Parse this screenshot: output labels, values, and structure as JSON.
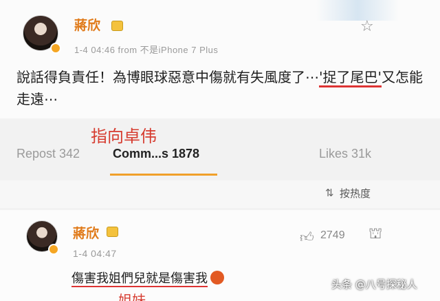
{
  "post": {
    "username": "蔣欣",
    "meta": "1-4 04:46  from 不是iPhone 7 Plus",
    "text_before": "說話得負責任！為博眼球惡意中傷就有失風度了⋯",
    "text_underlined": "'捉了尾巴'",
    "text_after": "又怎能走遠⋯"
  },
  "annotation_1": "指向卓伟",
  "actions": {
    "repost": "Repost 342",
    "comments": "Comm...s 1878",
    "likes": "Likes 31k"
  },
  "sort": {
    "label": "按热度"
  },
  "comment": {
    "username": "蔣欣",
    "meta": "1-4 04:47",
    "likes": "2749",
    "text": "傷害我姐們兒就是傷害我"
  },
  "annotation_2": "姐妹",
  "watermark": "头条 @八号探秘人",
  "icons": {
    "star": "star-icon",
    "like": "thumbs-up-icon",
    "reply": "reply-icon",
    "sort": "sort-icon",
    "verified": "verified-badge-icon",
    "emoji": "angry-emoji-icon"
  },
  "colors": {
    "username": "#e07a19",
    "annotation": "#d63b2f",
    "tab_underline": "#f0a02a"
  }
}
